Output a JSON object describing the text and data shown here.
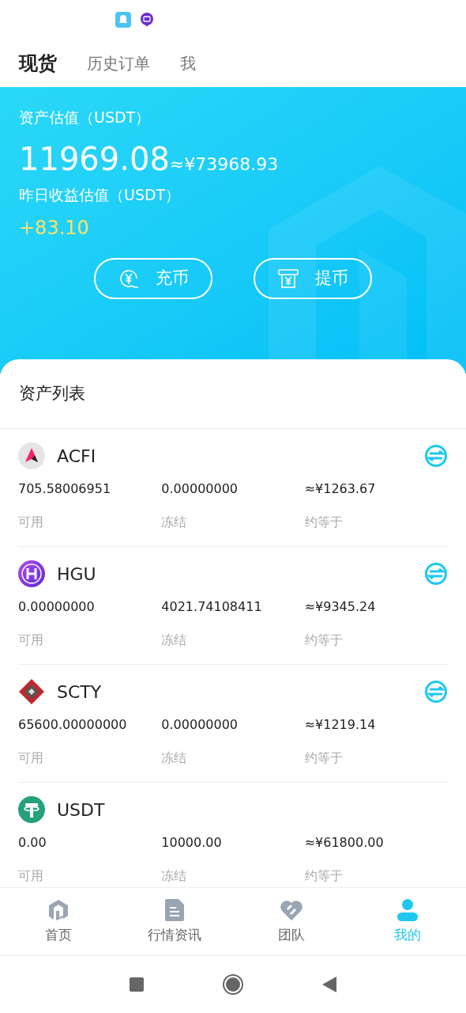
{
  "top_tabs": [
    {
      "label": "现货",
      "selected": true
    },
    {
      "label": "历史订单",
      "selected": false
    },
    {
      "label": "我",
      "selected": false
    }
  ],
  "summary": {
    "total_label": "资产估值（USDT）",
    "total_value": "11969.08",
    "total_cny": "≈¥73968.93",
    "yesterday_label": "昨日收益估值（USDT）",
    "yesterday_value": "+83.10"
  },
  "actions": [
    {
      "kind": "deposit",
      "label": "充币"
    },
    {
      "kind": "withdraw",
      "label": "提币"
    }
  ],
  "assets_title": "资产列表",
  "assets": [
    {
      "kind": "acfi",
      "symbol": "ACFI",
      "tradable": true,
      "available": "705.58006951",
      "frozen": "0.00000000",
      "approx": "≈¥1263.67",
      "available_label": "可用",
      "frozen_label": "冻结",
      "approx_label": "约等于"
    },
    {
      "kind": "hgu",
      "symbol": "HGU",
      "tradable": true,
      "available": "0.00000000",
      "frozen": "4021.74108411",
      "approx": "≈¥9345.24",
      "available_label": "可用",
      "frozen_label": "冻结",
      "approx_label": "约等于"
    },
    {
      "kind": "scty",
      "symbol": "SCTY",
      "tradable": true,
      "available": "65600.00000000",
      "frozen": "0.00000000",
      "approx": "≈¥1219.14",
      "available_label": "可用",
      "frozen_label": "冻结",
      "approx_label": "约等于"
    },
    {
      "kind": "usdt",
      "symbol": "USDT",
      "tradable": false,
      "available": "0.00",
      "frozen": "10000.00",
      "approx": "≈¥61800.00",
      "available_label": "可用",
      "frozen_label": "冻结",
      "approx_label": "约等于"
    }
  ],
  "bottom_nav": [
    {
      "kind": "home",
      "label": "首页",
      "selected": false
    },
    {
      "kind": "news",
      "label": "行情资讯",
      "selected": false
    },
    {
      "kind": "team",
      "label": "团队",
      "selected": false
    },
    {
      "kind": "me",
      "label": "我的",
      "selected": true
    }
  ]
}
